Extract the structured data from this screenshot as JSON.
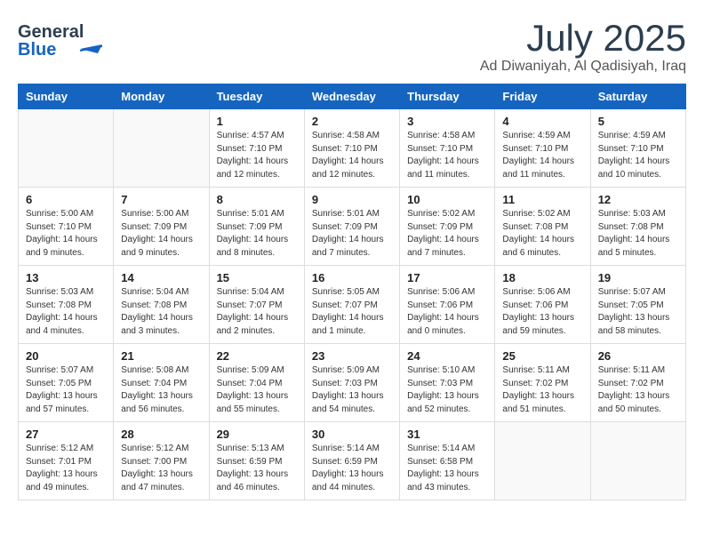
{
  "header": {
    "logo_line1": "General",
    "logo_line2": "Blue",
    "month": "July 2025",
    "location": "Ad Diwaniyah, Al Qadisiyah, Iraq"
  },
  "weekdays": [
    "Sunday",
    "Monday",
    "Tuesday",
    "Wednesday",
    "Thursday",
    "Friday",
    "Saturday"
  ],
  "weeks": [
    [
      {
        "day": "",
        "info": ""
      },
      {
        "day": "",
        "info": ""
      },
      {
        "day": "1",
        "info": "Sunrise: 4:57 AM\nSunset: 7:10 PM\nDaylight: 14 hours\nand 12 minutes."
      },
      {
        "day": "2",
        "info": "Sunrise: 4:58 AM\nSunset: 7:10 PM\nDaylight: 14 hours\nand 12 minutes."
      },
      {
        "day": "3",
        "info": "Sunrise: 4:58 AM\nSunset: 7:10 PM\nDaylight: 14 hours\nand 11 minutes."
      },
      {
        "day": "4",
        "info": "Sunrise: 4:59 AM\nSunset: 7:10 PM\nDaylight: 14 hours\nand 11 minutes."
      },
      {
        "day": "5",
        "info": "Sunrise: 4:59 AM\nSunset: 7:10 PM\nDaylight: 14 hours\nand 10 minutes."
      }
    ],
    [
      {
        "day": "6",
        "info": "Sunrise: 5:00 AM\nSunset: 7:10 PM\nDaylight: 14 hours\nand 9 minutes."
      },
      {
        "day": "7",
        "info": "Sunrise: 5:00 AM\nSunset: 7:09 PM\nDaylight: 14 hours\nand 9 minutes."
      },
      {
        "day": "8",
        "info": "Sunrise: 5:01 AM\nSunset: 7:09 PM\nDaylight: 14 hours\nand 8 minutes."
      },
      {
        "day": "9",
        "info": "Sunrise: 5:01 AM\nSunset: 7:09 PM\nDaylight: 14 hours\nand 7 minutes."
      },
      {
        "day": "10",
        "info": "Sunrise: 5:02 AM\nSunset: 7:09 PM\nDaylight: 14 hours\nand 7 minutes."
      },
      {
        "day": "11",
        "info": "Sunrise: 5:02 AM\nSunset: 7:08 PM\nDaylight: 14 hours\nand 6 minutes."
      },
      {
        "day": "12",
        "info": "Sunrise: 5:03 AM\nSunset: 7:08 PM\nDaylight: 14 hours\nand 5 minutes."
      }
    ],
    [
      {
        "day": "13",
        "info": "Sunrise: 5:03 AM\nSunset: 7:08 PM\nDaylight: 14 hours\nand 4 minutes."
      },
      {
        "day": "14",
        "info": "Sunrise: 5:04 AM\nSunset: 7:08 PM\nDaylight: 14 hours\nand 3 minutes."
      },
      {
        "day": "15",
        "info": "Sunrise: 5:04 AM\nSunset: 7:07 PM\nDaylight: 14 hours\nand 2 minutes."
      },
      {
        "day": "16",
        "info": "Sunrise: 5:05 AM\nSunset: 7:07 PM\nDaylight: 14 hours\nand 1 minute."
      },
      {
        "day": "17",
        "info": "Sunrise: 5:06 AM\nSunset: 7:06 PM\nDaylight: 14 hours\nand 0 minutes."
      },
      {
        "day": "18",
        "info": "Sunrise: 5:06 AM\nSunset: 7:06 PM\nDaylight: 13 hours\nand 59 minutes."
      },
      {
        "day": "19",
        "info": "Sunrise: 5:07 AM\nSunset: 7:05 PM\nDaylight: 13 hours\nand 58 minutes."
      }
    ],
    [
      {
        "day": "20",
        "info": "Sunrise: 5:07 AM\nSunset: 7:05 PM\nDaylight: 13 hours\nand 57 minutes."
      },
      {
        "day": "21",
        "info": "Sunrise: 5:08 AM\nSunset: 7:04 PM\nDaylight: 13 hours\nand 56 minutes."
      },
      {
        "day": "22",
        "info": "Sunrise: 5:09 AM\nSunset: 7:04 PM\nDaylight: 13 hours\nand 55 minutes."
      },
      {
        "day": "23",
        "info": "Sunrise: 5:09 AM\nSunset: 7:03 PM\nDaylight: 13 hours\nand 54 minutes."
      },
      {
        "day": "24",
        "info": "Sunrise: 5:10 AM\nSunset: 7:03 PM\nDaylight: 13 hours\nand 52 minutes."
      },
      {
        "day": "25",
        "info": "Sunrise: 5:11 AM\nSunset: 7:02 PM\nDaylight: 13 hours\nand 51 minutes."
      },
      {
        "day": "26",
        "info": "Sunrise: 5:11 AM\nSunset: 7:02 PM\nDaylight: 13 hours\nand 50 minutes."
      }
    ],
    [
      {
        "day": "27",
        "info": "Sunrise: 5:12 AM\nSunset: 7:01 PM\nDaylight: 13 hours\nand 49 minutes."
      },
      {
        "day": "28",
        "info": "Sunrise: 5:12 AM\nSunset: 7:00 PM\nDaylight: 13 hours\nand 47 minutes."
      },
      {
        "day": "29",
        "info": "Sunrise: 5:13 AM\nSunset: 6:59 PM\nDaylight: 13 hours\nand 46 minutes."
      },
      {
        "day": "30",
        "info": "Sunrise: 5:14 AM\nSunset: 6:59 PM\nDaylight: 13 hours\nand 44 minutes."
      },
      {
        "day": "31",
        "info": "Sunrise: 5:14 AM\nSunset: 6:58 PM\nDaylight: 13 hours\nand 43 minutes."
      },
      {
        "day": "",
        "info": ""
      },
      {
        "day": "",
        "info": ""
      }
    ]
  ]
}
